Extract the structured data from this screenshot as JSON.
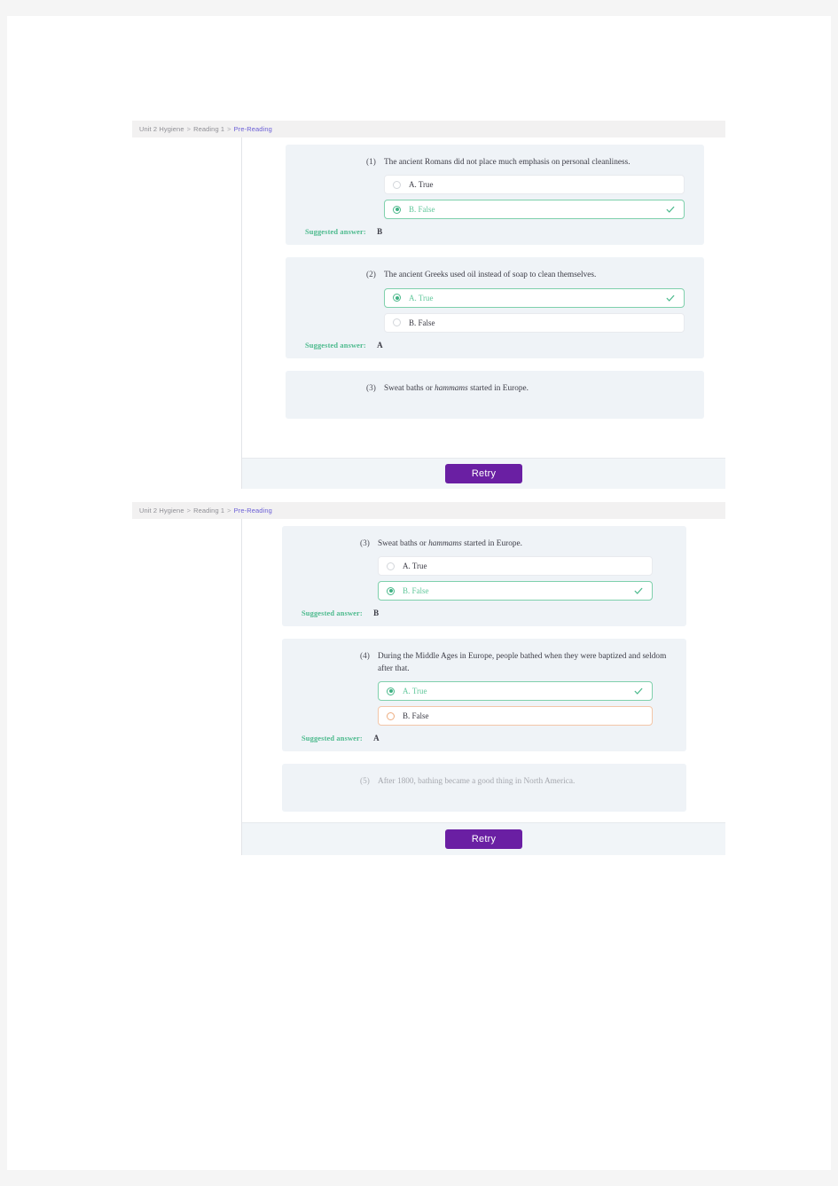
{
  "breadcrumb": {
    "unit": "Unit 2 Hygiene",
    "reading": "Reading 1",
    "current": "Pre-Reading",
    "separator": ">"
  },
  "footer": {
    "retry_label": "Retry"
  },
  "labels": {
    "suggested_answer": "Suggested answer:"
  },
  "colors": {
    "correct_green": "#4cba8d",
    "wrong_orange": "#eead80",
    "retry_purple": "#6a1fa3",
    "breadcrumb_link": "#6b5fd6",
    "card_background": "#eff3f7"
  },
  "panels": [
    {
      "id": "panel-top",
      "questions": [
        {
          "number": "(1)",
          "text": "The ancient Romans did not place much emphasis on personal cleanliness.",
          "italic_term": "",
          "options": [
            {
              "id": "q1-a",
              "label": "A. True",
              "state": "normal",
              "selected": false,
              "check": false
            },
            {
              "id": "q1-b",
              "label": "B. False",
              "state": "correct",
              "selected": true,
              "check": true
            }
          ],
          "suggested": "B"
        },
        {
          "number": "(2)",
          "text": "The ancient Greeks used oil instead of soap to clean themselves.",
          "italic_term": "",
          "options": [
            {
              "id": "q2-a",
              "label": "A. True",
              "state": "correct",
              "selected": true,
              "check": true
            },
            {
              "id": "q2-b",
              "label": "B. False",
              "state": "normal",
              "selected": false,
              "check": false
            }
          ],
          "suggested": "A"
        },
        {
          "number": "(3)",
          "text_before": "Sweat baths or ",
          "italic_term": "hammams",
          "text_after": " started in Europe.",
          "clipped": true,
          "options": [],
          "suggested": ""
        }
      ]
    },
    {
      "id": "panel-bottom",
      "questions": [
        {
          "number": "(3)",
          "text_before": "Sweat baths or ",
          "italic_term": "hammams",
          "text_after": " started in Europe.",
          "options": [
            {
              "id": "q3-a",
              "label": "A. True",
              "state": "normal",
              "selected": false,
              "check": false
            },
            {
              "id": "q3-b",
              "label": "B. False",
              "state": "correct",
              "selected": true,
              "check": true
            }
          ],
          "suggested": "B"
        },
        {
          "number": "(4)",
          "text": "During the Middle Ages in Europe, people bathed when they were baptized and seldom after that.",
          "italic_term": "",
          "options": [
            {
              "id": "q4-a",
              "label": "A. True",
              "state": "correct",
              "selected": true,
              "check": true
            },
            {
              "id": "q4-b",
              "label": "B. False",
              "state": "wrong",
              "selected": false,
              "check": false
            }
          ],
          "suggested": "A"
        },
        {
          "number": "(5)",
          "text": "After 1800, bathing became a good thing in North America.",
          "italic_term": "",
          "clipped": true,
          "options": [],
          "suggested": ""
        }
      ]
    }
  ]
}
